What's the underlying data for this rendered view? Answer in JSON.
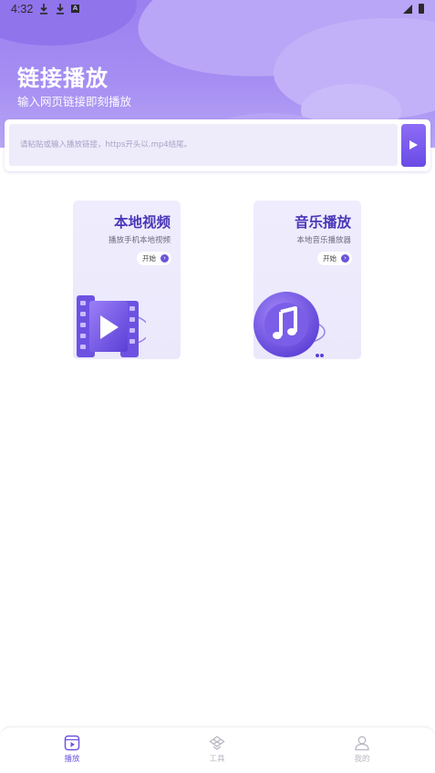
{
  "status_bar": {
    "time": "4:32",
    "icons": [
      "download-icon",
      "download-icon",
      "text-icon",
      "signal-icon",
      "battery-icon"
    ],
    "a_glyph": "A"
  },
  "header": {
    "title": "链接播放",
    "subtitle": "输入网页链接即刻播放"
  },
  "url_input": {
    "placeholder": "请粘贴或输入播放链接，https开头以.mp4结尾。",
    "value": "",
    "play_icon": "play-icon"
  },
  "cards": [
    {
      "title": "本地视频",
      "desc": "播放手机本地视频",
      "button": "开始",
      "icon": "film-play-icon"
    },
    {
      "title": "音乐播放",
      "desc": "本地音乐播放器",
      "button": "开始",
      "icon": "music-note-icon"
    }
  ],
  "bottom_nav": {
    "active": "播放",
    "items": [
      {
        "label": "播放",
        "icon": "play-box-icon"
      },
      {
        "label": "工具",
        "icon": "tools-icon"
      },
      {
        "label": "我的",
        "icon": "user-icon"
      }
    ]
  },
  "colors": {
    "accent": "#6f55e0",
    "header_bg": "#a58ef2",
    "card_bg": "#efedfd",
    "card_title": "#4a37b8"
  }
}
